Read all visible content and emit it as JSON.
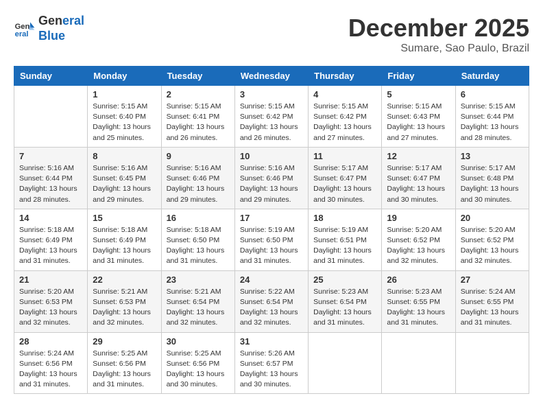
{
  "header": {
    "logo_line1": "General",
    "logo_line2": "Blue",
    "month": "December 2025",
    "location": "Sumare, Sao Paulo, Brazil"
  },
  "days_of_week": [
    "Sunday",
    "Monday",
    "Tuesday",
    "Wednesday",
    "Thursday",
    "Friday",
    "Saturday"
  ],
  "weeks": [
    [
      {
        "day": "",
        "empty": true
      },
      {
        "day": "1",
        "sunrise": "Sunrise: 5:15 AM",
        "sunset": "Sunset: 6:40 PM",
        "daylight": "Daylight: 13 hours and 25 minutes."
      },
      {
        "day": "2",
        "sunrise": "Sunrise: 5:15 AM",
        "sunset": "Sunset: 6:41 PM",
        "daylight": "Daylight: 13 hours and 26 minutes."
      },
      {
        "day": "3",
        "sunrise": "Sunrise: 5:15 AM",
        "sunset": "Sunset: 6:42 PM",
        "daylight": "Daylight: 13 hours and 26 minutes."
      },
      {
        "day": "4",
        "sunrise": "Sunrise: 5:15 AM",
        "sunset": "Sunset: 6:42 PM",
        "daylight": "Daylight: 13 hours and 27 minutes."
      },
      {
        "day": "5",
        "sunrise": "Sunrise: 5:15 AM",
        "sunset": "Sunset: 6:43 PM",
        "daylight": "Daylight: 13 hours and 27 minutes."
      },
      {
        "day": "6",
        "sunrise": "Sunrise: 5:15 AM",
        "sunset": "Sunset: 6:44 PM",
        "daylight": "Daylight: 13 hours and 28 minutes."
      }
    ],
    [
      {
        "day": "7",
        "sunrise": "Sunrise: 5:16 AM",
        "sunset": "Sunset: 6:44 PM",
        "daylight": "Daylight: 13 hours and 28 minutes."
      },
      {
        "day": "8",
        "sunrise": "Sunrise: 5:16 AM",
        "sunset": "Sunset: 6:45 PM",
        "daylight": "Daylight: 13 hours and 29 minutes."
      },
      {
        "day": "9",
        "sunrise": "Sunrise: 5:16 AM",
        "sunset": "Sunset: 6:46 PM",
        "daylight": "Daylight: 13 hours and 29 minutes."
      },
      {
        "day": "10",
        "sunrise": "Sunrise: 5:16 AM",
        "sunset": "Sunset: 6:46 PM",
        "daylight": "Daylight: 13 hours and 29 minutes."
      },
      {
        "day": "11",
        "sunrise": "Sunrise: 5:17 AM",
        "sunset": "Sunset: 6:47 PM",
        "daylight": "Daylight: 13 hours and 30 minutes."
      },
      {
        "day": "12",
        "sunrise": "Sunrise: 5:17 AM",
        "sunset": "Sunset: 6:47 PM",
        "daylight": "Daylight: 13 hours and 30 minutes."
      },
      {
        "day": "13",
        "sunrise": "Sunrise: 5:17 AM",
        "sunset": "Sunset: 6:48 PM",
        "daylight": "Daylight: 13 hours and 30 minutes."
      }
    ],
    [
      {
        "day": "14",
        "sunrise": "Sunrise: 5:18 AM",
        "sunset": "Sunset: 6:49 PM",
        "daylight": "Daylight: 13 hours and 31 minutes."
      },
      {
        "day": "15",
        "sunrise": "Sunrise: 5:18 AM",
        "sunset": "Sunset: 6:49 PM",
        "daylight": "Daylight: 13 hours and 31 minutes."
      },
      {
        "day": "16",
        "sunrise": "Sunrise: 5:18 AM",
        "sunset": "Sunset: 6:50 PM",
        "daylight": "Daylight: 13 hours and 31 minutes."
      },
      {
        "day": "17",
        "sunrise": "Sunrise: 5:19 AM",
        "sunset": "Sunset: 6:50 PM",
        "daylight": "Daylight: 13 hours and 31 minutes."
      },
      {
        "day": "18",
        "sunrise": "Sunrise: 5:19 AM",
        "sunset": "Sunset: 6:51 PM",
        "daylight": "Daylight: 13 hours and 31 minutes."
      },
      {
        "day": "19",
        "sunrise": "Sunrise: 5:20 AM",
        "sunset": "Sunset: 6:52 PM",
        "daylight": "Daylight: 13 hours and 32 minutes."
      },
      {
        "day": "20",
        "sunrise": "Sunrise: 5:20 AM",
        "sunset": "Sunset: 6:52 PM",
        "daylight": "Daylight: 13 hours and 32 minutes."
      }
    ],
    [
      {
        "day": "21",
        "sunrise": "Sunrise: 5:20 AM",
        "sunset": "Sunset: 6:53 PM",
        "daylight": "Daylight: 13 hours and 32 minutes."
      },
      {
        "day": "22",
        "sunrise": "Sunrise: 5:21 AM",
        "sunset": "Sunset: 6:53 PM",
        "daylight": "Daylight: 13 hours and 32 minutes."
      },
      {
        "day": "23",
        "sunrise": "Sunrise: 5:21 AM",
        "sunset": "Sunset: 6:54 PM",
        "daylight": "Daylight: 13 hours and 32 minutes."
      },
      {
        "day": "24",
        "sunrise": "Sunrise: 5:22 AM",
        "sunset": "Sunset: 6:54 PM",
        "daylight": "Daylight: 13 hours and 32 minutes."
      },
      {
        "day": "25",
        "sunrise": "Sunrise: 5:23 AM",
        "sunset": "Sunset: 6:54 PM",
        "daylight": "Daylight: 13 hours and 31 minutes."
      },
      {
        "day": "26",
        "sunrise": "Sunrise: 5:23 AM",
        "sunset": "Sunset: 6:55 PM",
        "daylight": "Daylight: 13 hours and 31 minutes."
      },
      {
        "day": "27",
        "sunrise": "Sunrise: 5:24 AM",
        "sunset": "Sunset: 6:55 PM",
        "daylight": "Daylight: 13 hours and 31 minutes."
      }
    ],
    [
      {
        "day": "28",
        "sunrise": "Sunrise: 5:24 AM",
        "sunset": "Sunset: 6:56 PM",
        "daylight": "Daylight: 13 hours and 31 minutes."
      },
      {
        "day": "29",
        "sunrise": "Sunrise: 5:25 AM",
        "sunset": "Sunset: 6:56 PM",
        "daylight": "Daylight: 13 hours and 31 minutes."
      },
      {
        "day": "30",
        "sunrise": "Sunrise: 5:25 AM",
        "sunset": "Sunset: 6:56 PM",
        "daylight": "Daylight: 13 hours and 30 minutes."
      },
      {
        "day": "31",
        "sunrise": "Sunrise: 5:26 AM",
        "sunset": "Sunset: 6:57 PM",
        "daylight": "Daylight: 13 hours and 30 minutes."
      },
      {
        "day": "",
        "empty": true
      },
      {
        "day": "",
        "empty": true
      },
      {
        "day": "",
        "empty": true
      }
    ]
  ]
}
